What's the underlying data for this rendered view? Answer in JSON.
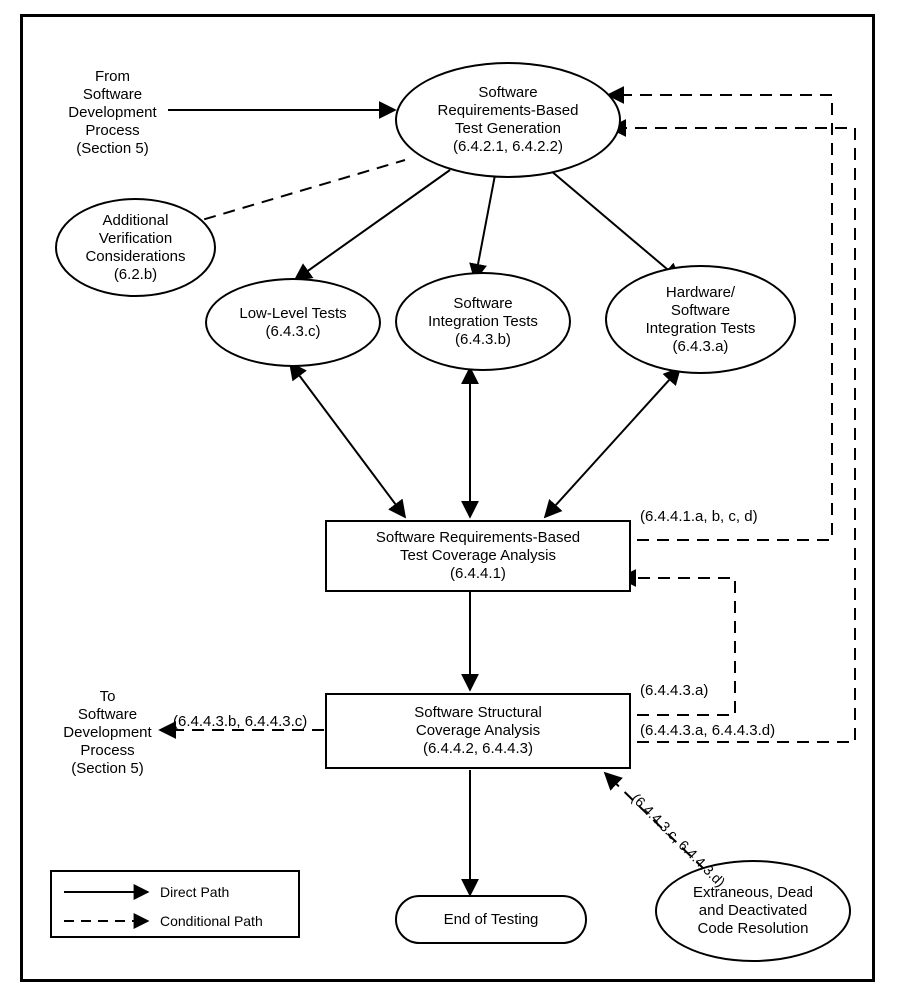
{
  "nodes": {
    "from_dev": "From\nSoftware\nDevelopment\nProcess\n(Section 5)",
    "req_test_gen": "Software\nRequirements-Based\nTest Generation\n(6.4.2.1, 6.4.2.2)",
    "addl_verif": "Additional\nVerification\nConsiderations\n(6.2.b)",
    "low_level": "Low-Level Tests\n(6.4.3.c)",
    "sw_integ": "Software\nIntegration Tests\n(6.4.3.b)",
    "hw_sw_integ": "Hardware/\nSoftware\nIntegration Tests\n(6.4.3.a)",
    "req_cov": "Software Requirements-Based\nTest Coverage Analysis\n(6.4.4.1)",
    "struct_cov": "Software Structural\nCoverage Analysis\n(6.4.4.2, 6.4.4.3)",
    "to_dev": "To\nSoftware\nDevelopment\nProcess\n(Section 5)",
    "end_testing": "End of Testing",
    "extraneous": "Extraneous, Dead\nand Deactivated\nCode Resolution"
  },
  "edge_labels": {
    "reqcov_to_gen": "(6.4.4.1.a, b, c, d)",
    "struct_to_reqcov": "(6.4.4.3.a)",
    "struct_to_gen": "(6.4.4.3.a, 6.4.4.3.d)",
    "struct_to_dev": "(6.4.4.3.b, 6.4.4.3.c)",
    "extraneous_to_struct": "(6.4.4.3.c, 6.4.4.3.d)"
  },
  "legend": {
    "direct": "Direct Path",
    "conditional": "Conditional Path"
  }
}
